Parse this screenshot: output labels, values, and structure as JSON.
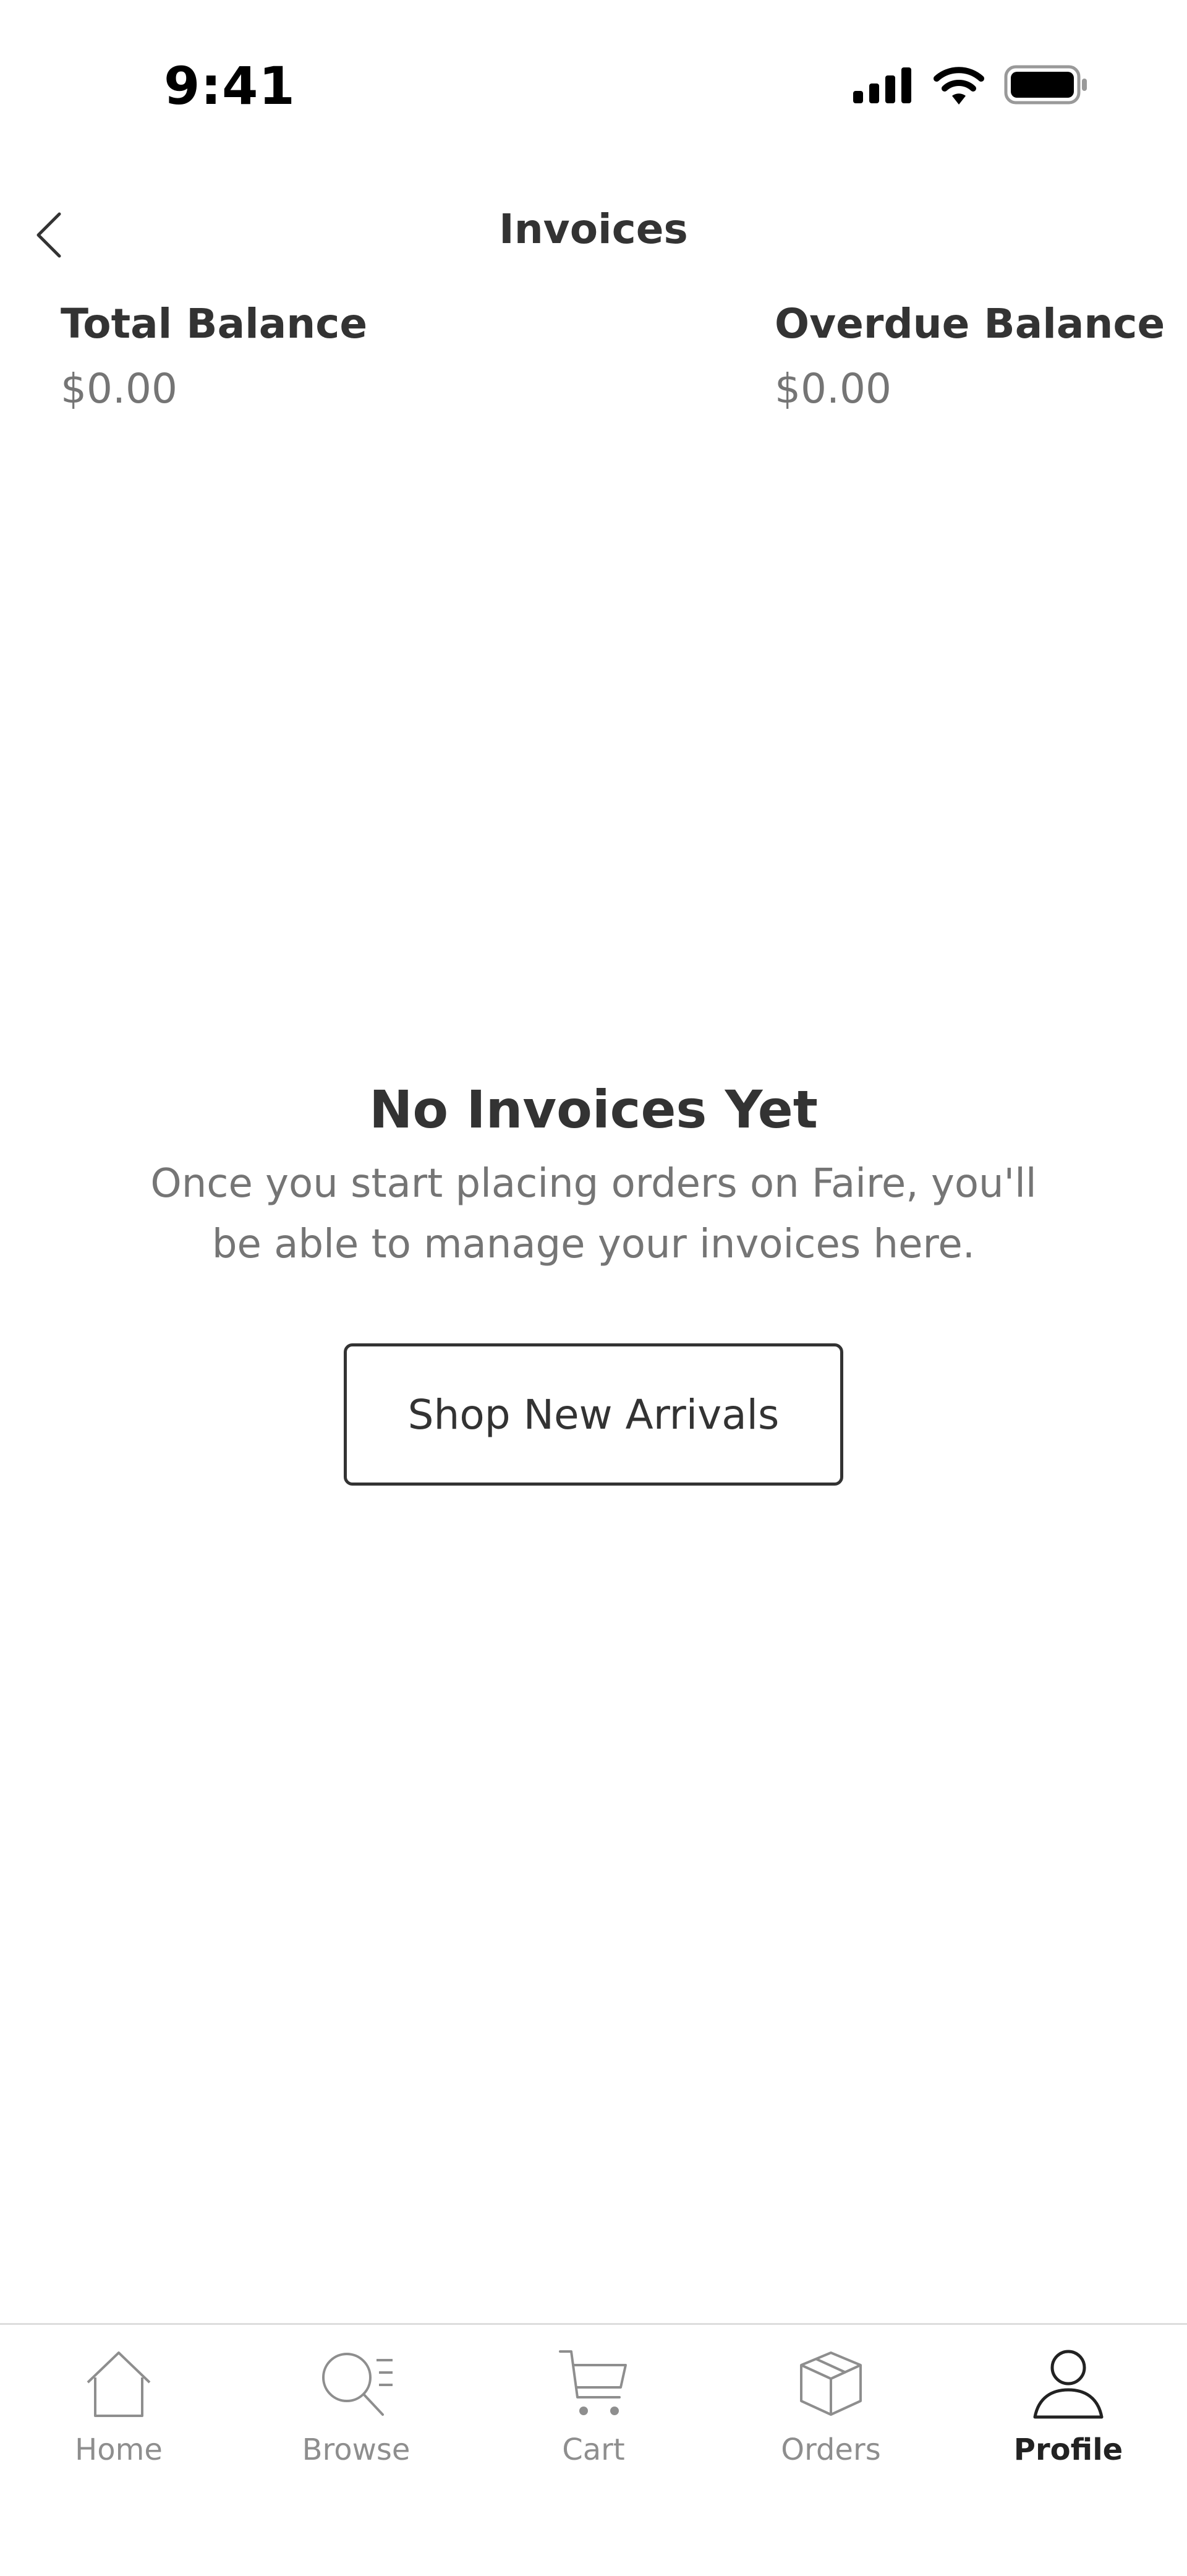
{
  "status_bar": {
    "time": "9:41"
  },
  "header": {
    "title": "Invoices"
  },
  "balances": {
    "total": {
      "label": "Total Balance",
      "value": "$0.00"
    },
    "overdue": {
      "label": "Overdue Balance",
      "value": "$0.00"
    }
  },
  "empty_state": {
    "title": "No Invoices Yet",
    "message_line1": "Once you start placing orders on Faire, you'll",
    "message_line2": "be able to manage your invoices here.",
    "button_label": "Shop New Arrivals"
  },
  "tab_bar": {
    "tabs": [
      {
        "label": "Home",
        "icon": "home-icon",
        "active": false
      },
      {
        "label": "Browse",
        "icon": "browse-icon",
        "active": false
      },
      {
        "label": "Cart",
        "icon": "cart-icon",
        "active": false
      },
      {
        "label": "Orders",
        "icon": "orders-box-icon",
        "active": false
      },
      {
        "label": "Profile",
        "icon": "profile-icon",
        "active": true
      }
    ]
  },
  "colors": {
    "text": "#333333",
    "muted": "#757575",
    "tab_inactive": "#8e8e8e",
    "divider": "#dddddd"
  }
}
